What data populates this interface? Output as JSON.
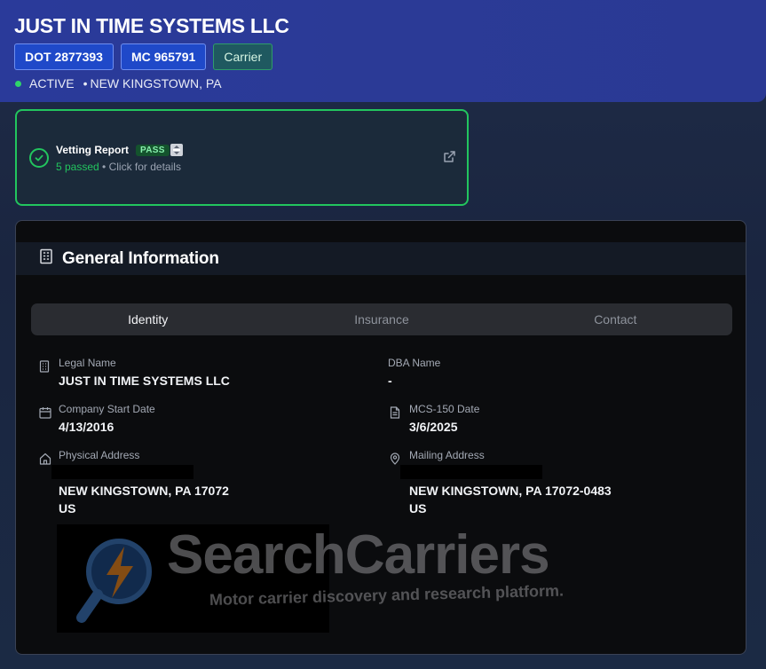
{
  "header": {
    "company_name": "JUST IN TIME SYSTEMS LLC",
    "badges": [
      "DOT 2877393",
      "MC 965791",
      "Carrier"
    ],
    "status": "ACTIVE",
    "location": "NEW KINGSTOWN, PA"
  },
  "vetting": {
    "title": "Vetting Report",
    "badge": "PASS",
    "passed": "5 passed",
    "details": "• Click for details"
  },
  "general": {
    "title": "General Information",
    "tabs": [
      "Identity",
      "Insurance",
      "Contact"
    ],
    "active_tab": "Identity",
    "fields": {
      "legal_name_label": "Legal Name",
      "legal_name": "JUST IN TIME SYSTEMS LLC",
      "dba_label": "DBA Name",
      "dba": "-",
      "start_date_label": "Company Start Date",
      "start_date": "4/13/2016",
      "mcs150_label": "MCS-150 Date",
      "mcs150": "3/6/2025",
      "physical_label": "Physical Address",
      "physical_line2": "NEW KINGSTOWN, PA 17072",
      "physical_line3": "US",
      "mailing_label": "Mailing Address",
      "mailing_line2": "NEW KINGSTOWN, PA 17072-0483",
      "mailing_line3": "US"
    }
  },
  "watermark": {
    "title": "SearchCarriers",
    "subtitle": "Motor carrier discovery and research platform."
  },
  "colors": {
    "header_bg": "#2b3a96",
    "badge_blue": "#1f49c9",
    "accent_green": "#22c55e",
    "panel_bg": "#0b0c0e"
  },
  "icons": [
    "check-circle-icon",
    "external-link-icon",
    "building-icon",
    "calendar-icon",
    "document-icon",
    "home-icon",
    "map-pin-icon"
  ]
}
